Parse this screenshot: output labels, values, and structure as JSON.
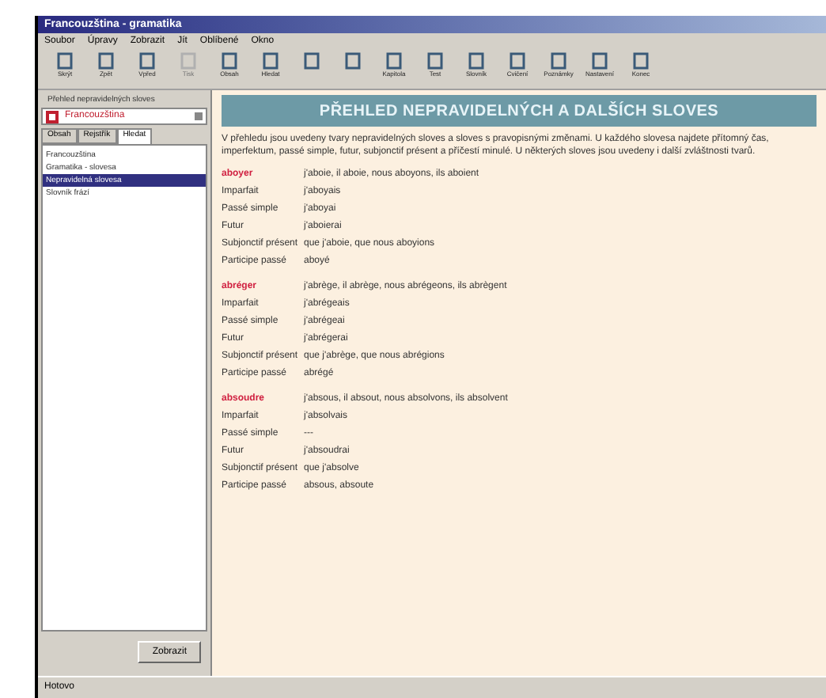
{
  "window": {
    "title": "Francouzština - gramatika"
  },
  "menu": [
    "Soubor",
    "Úpravy",
    "Zobrazit",
    "Jít",
    "Oblíbené",
    "Okno"
  ],
  "toolbar": [
    {
      "label": "Skrýt",
      "disabled": false
    },
    {
      "label": "Zpět",
      "disabled": false
    },
    {
      "label": "Vpřed",
      "disabled": false
    },
    {
      "label": "Tisk",
      "disabled": true
    },
    {
      "label": "Obsah",
      "disabled": false
    },
    {
      "label": "Hledat",
      "disabled": false
    },
    {
      "disabled": false
    },
    {
      "disabled": false
    },
    {
      "label": "Kapitola",
      "disabled": false
    },
    {
      "label": "Test",
      "disabled": false
    },
    {
      "label": "Slovník",
      "disabled": false
    },
    {
      "label": "Cvičení",
      "disabled": false
    },
    {
      "label": "Poznámky",
      "disabled": false
    },
    {
      "label": "Nastavení",
      "disabled": false
    },
    {
      "label": "Konec",
      "disabled": false
    }
  ],
  "sidebar": {
    "title": "Přehled nepravidelných sloves",
    "dropdown": "Francouzština",
    "tabs": [
      {
        "label": "Obsah",
        "selected": false
      },
      {
        "label": "Rejstřík",
        "selected": false
      },
      {
        "label": "Hledat",
        "selected": true
      }
    ],
    "items": [
      {
        "label": "Francouzština",
        "selected": false
      },
      {
        "label": "Gramatika - slovesa",
        "selected": false
      },
      {
        "label": "Nepravidelná slovesa",
        "selected": true
      },
      {
        "label": "Slovník frází",
        "selected": false
      }
    ],
    "button": "Zobrazit"
  },
  "content": {
    "heading": "PŘEHLED NEPRAVIDELNÝCH A DALŠÍCH SLOVES",
    "intro": "V přehledu jsou uvedeny tvary nepravidelných sloves a sloves s pravopisnými změnami. U každého slovesa najdete přítomný čas, imperfektum, passé simple, futur, subjonctif présent a příčestí minulé. U některých sloves jsou uvedeny i další zvláštnosti tvarů.",
    "verbs": [
      {
        "verb": "aboyer",
        "forms": "j'aboie, il aboie, nous aboyons, ils aboient",
        "rows": [
          {
            "label": "Imparfait",
            "value": "j'aboyais"
          },
          {
            "label": "Passé simple",
            "value": "j'aboyai"
          },
          {
            "label": "Futur",
            "value": "j'aboierai"
          },
          {
            "label": "Subjonctif présent",
            "value": "que j'aboie, que nous aboyions"
          },
          {
            "label": "Participe passé",
            "value": "aboyé"
          }
        ]
      },
      {
        "verb": "abréger",
        "forms": "j'abrège, il abrège, nous abrégeons, ils abrègent",
        "rows": [
          {
            "label": "Imparfait",
            "value": "j'abrégeais"
          },
          {
            "label": "Passé simple",
            "value": "j'abrégeai"
          },
          {
            "label": "Futur",
            "value": "j'abrégerai"
          },
          {
            "label": "Subjonctif présent",
            "value": "que j'abrège, que nous abrégions"
          },
          {
            "label": "Participe passé",
            "value": "abrégé"
          }
        ]
      },
      {
        "verb": "absoudre",
        "forms": "j'absous, il absout, nous absolvons, ils absolvent",
        "rows": [
          {
            "label": "Imparfait",
            "value": "j'absolvais"
          },
          {
            "label": "Passé simple",
            "value": "---"
          },
          {
            "label": "Futur",
            "value": "j'absoudrai"
          },
          {
            "label": "Subjonctif présent",
            "value": "que j'absolve"
          },
          {
            "label": "Participe passé",
            "value": "absous, absoute"
          }
        ]
      }
    ]
  },
  "status_bar": {
    "text": "Hotovo"
  }
}
